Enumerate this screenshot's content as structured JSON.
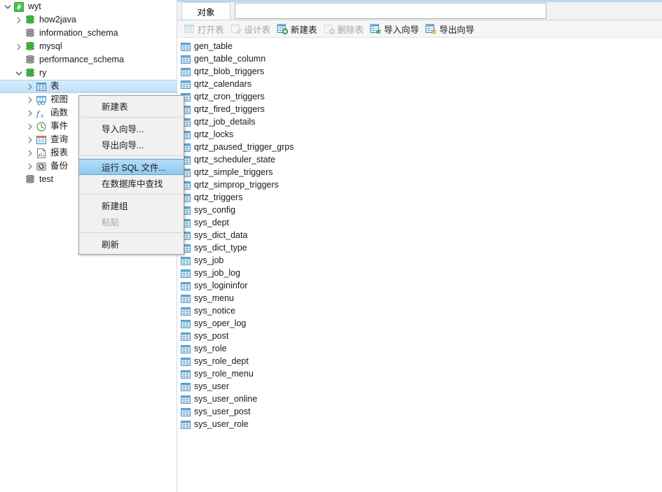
{
  "sidebar": {
    "tree": [
      {
        "label": "wyt",
        "depth": 0,
        "twisty": "expanded",
        "icon": "connection-icon",
        "selected": false
      },
      {
        "label": "how2java",
        "depth": 1,
        "twisty": "collapsed",
        "icon": "database-green-icon",
        "selected": false
      },
      {
        "label": "information_schema",
        "depth": 1,
        "twisty": "none",
        "icon": "database-gray-icon",
        "selected": false
      },
      {
        "label": "mysql",
        "depth": 1,
        "twisty": "collapsed",
        "icon": "database-green-icon",
        "selected": false
      },
      {
        "label": "performance_schema",
        "depth": 1,
        "twisty": "none",
        "icon": "database-gray-icon",
        "selected": false
      },
      {
        "label": "ry",
        "depth": 1,
        "twisty": "expanded",
        "icon": "database-green-icon",
        "selected": false
      },
      {
        "label": "表",
        "depth": 2,
        "twisty": "collapsed",
        "icon": "table-icon",
        "selected": true
      },
      {
        "label": "视图",
        "depth": 2,
        "twisty": "collapsed",
        "icon": "view-icon",
        "selected": false
      },
      {
        "label": "函数",
        "depth": 2,
        "twisty": "collapsed",
        "icon": "function-fx-icon",
        "selected": false
      },
      {
        "label": "事件",
        "depth": 2,
        "twisty": "collapsed",
        "icon": "event-clock-icon",
        "selected": false
      },
      {
        "label": "查询",
        "depth": 2,
        "twisty": "collapsed",
        "icon": "query-icon",
        "selected": false
      },
      {
        "label": "报表",
        "depth": 2,
        "twisty": "collapsed",
        "icon": "report-icon",
        "selected": false
      },
      {
        "label": "备份",
        "depth": 2,
        "twisty": "collapsed",
        "icon": "backup-icon",
        "selected": false
      },
      {
        "label": "test",
        "depth": 1,
        "twisty": "none",
        "icon": "database-gray-icon",
        "selected": false
      }
    ]
  },
  "context_menu": {
    "items": [
      {
        "label": "新建表",
        "state": "normal",
        "separator_after": true
      },
      {
        "label": "导入向导...",
        "state": "normal",
        "separator_after": false
      },
      {
        "label": "导出向导...",
        "state": "normal",
        "separator_after": true
      },
      {
        "label": "运行 SQL 文件...",
        "state": "highlighted",
        "separator_after": false
      },
      {
        "label": "在数据库中查找",
        "state": "normal",
        "separator_after": true
      },
      {
        "label": "新建组",
        "state": "normal",
        "separator_after": false
      },
      {
        "label": "粘贴",
        "state": "disabled",
        "separator_after": true
      },
      {
        "label": "刷新",
        "state": "normal",
        "separator_after": false
      }
    ]
  },
  "right_pane": {
    "tab": {
      "label": "对象"
    },
    "filter": {
      "value": "",
      "placeholder": ""
    },
    "toolbar": [
      {
        "label": "打开表",
        "icon": "open-table-icon",
        "enabled": false
      },
      {
        "label": "设计表",
        "icon": "design-table-icon",
        "enabled": false
      },
      {
        "label": "新建表",
        "icon": "new-table-icon",
        "enabled": true
      },
      {
        "label": "删除表",
        "icon": "delete-table-icon",
        "enabled": false
      },
      {
        "label": "导入向导",
        "icon": "import-wizard-icon",
        "enabled": true
      },
      {
        "label": "导出向导",
        "icon": "export-wizard-icon",
        "enabled": true
      }
    ],
    "tables": [
      "gen_table",
      "gen_table_column",
      "qrtz_blob_triggers",
      "qrtz_calendars",
      "qrtz_cron_triggers",
      "qrtz_fired_triggers",
      "qrtz_job_details",
      "qrtz_locks",
      "qrtz_paused_trigger_grps",
      "qrtz_scheduler_state",
      "qrtz_simple_triggers",
      "qrtz_simprop_triggers",
      "qrtz_triggers",
      "sys_config",
      "sys_dept",
      "sys_dict_data",
      "sys_dict_type",
      "sys_job",
      "sys_job_log",
      "sys_logininfor",
      "sys_menu",
      "sys_notice",
      "sys_oper_log",
      "sys_post",
      "sys_role",
      "sys_role_dept",
      "sys_role_menu",
      "sys_user",
      "sys_user_online",
      "sys_user_post",
      "sys_user_role"
    ]
  },
  "colors": {
    "selection": "#c3e0f7",
    "menu_highlight": "#8fc9ef",
    "database_connected": "#39a845",
    "database_inactive": "#8a8a8a",
    "table_icon": "#4a90c4",
    "connection_icon": "#44c14a"
  }
}
